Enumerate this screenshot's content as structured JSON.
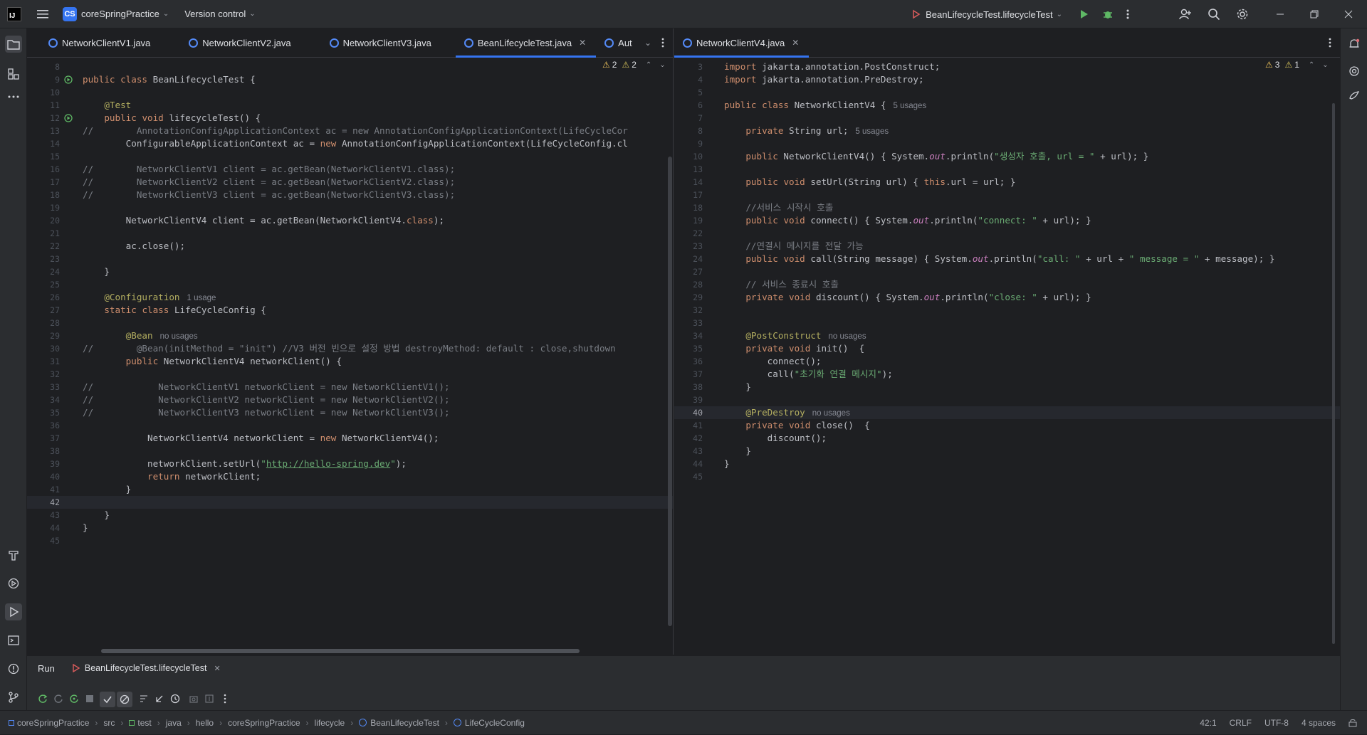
{
  "titlebar": {
    "project_badge": "CS",
    "project_name": "coreSpringPractice",
    "vcs": "Version control",
    "run_config": "BeanLifecycleTest.lifecycleTest"
  },
  "left_editor": {
    "tabs": [
      {
        "label": "NetworkClientV1.java",
        "active": false
      },
      {
        "label": "NetworkClientV2.java",
        "active": false
      },
      {
        "label": "NetworkClientV3.java",
        "active": false
      },
      {
        "label": "BeanLifecycleTest.java",
        "active": true
      },
      {
        "label": "AutoAppCon",
        "active": false
      }
    ],
    "warnings": "2",
    "weak_warnings": "2"
  },
  "right_editor": {
    "tabs": [
      {
        "label": "NetworkClientV4.java",
        "active": true
      }
    ],
    "warnings": "3",
    "weak_warnings": "1"
  },
  "run_panel": {
    "tab_run": "Run",
    "tab_config": "BeanLifecycleTest.lifecycleTest"
  },
  "statusbar": {
    "breadcrumbs": [
      "coreSpringPractice",
      "src",
      "test",
      "java",
      "hello",
      "coreSpringPractice",
      "lifecycle",
      "BeanLifecycleTest",
      "LifeCycleConfig"
    ],
    "position": "42:1",
    "line_sep": "CRLF",
    "encoding": "UTF-8",
    "indent": "4 spaces"
  },
  "colors": {
    "accent": "#3574f0",
    "keyword": "#cf8e6d",
    "annotation": "#b3ae60",
    "string": "#6aab73",
    "comment": "#7a7e85",
    "function": "#56a8f5",
    "field": "#c77dbb",
    "warning": "#f2c55c"
  },
  "icons": [
    "menu-icon",
    "run-icon",
    "debug-icon",
    "more-icon",
    "add-user-icon",
    "search-icon",
    "gear-icon",
    "minimize-icon",
    "maximize-icon",
    "close-icon",
    "folder-icon",
    "structure-icon",
    "build-icon",
    "services-icon",
    "run-tool-icon",
    "terminal-icon",
    "problems-icon",
    "git-icon",
    "notifications-icon",
    "ai-icon",
    "database-icon"
  ],
  "left_code": [
    {
      "n": "8",
      "t": ""
    },
    {
      "n": "9",
      "t": "public class BeanLifecycleTest {",
      "run": true
    },
    {
      "n": "10",
      "t": ""
    },
    {
      "n": "11",
      "t": "    @Test"
    },
    {
      "n": "12",
      "t": "    public void lifecycleTest() {",
      "run": true
    },
    {
      "n": "13",
      "t": "//        AnnotationConfigApplicationContext ac = new AnnotationConfigApplicationContext(LifeCycleCor"
    },
    {
      "n": "14",
      "t": "        ConfigurableApplicationContext ac = new AnnotationConfigApplicationContext(LifeCycleConfig.cl"
    },
    {
      "n": "15",
      "t": ""
    },
    {
      "n": "16",
      "t": "//        NetworkClientV1 client = ac.getBean(NetworkClientV1.class);"
    },
    {
      "n": "17",
      "t": "//        NetworkClientV2 client = ac.getBean(NetworkClientV2.class);"
    },
    {
      "n": "18",
      "t": "//        NetworkClientV3 client = ac.getBean(NetworkClientV3.class);"
    },
    {
      "n": "19",
      "t": ""
    },
    {
      "n": "20",
      "t": "        NetworkClientV4 client = ac.getBean(NetworkClientV4.class);"
    },
    {
      "n": "21",
      "t": ""
    },
    {
      "n": "22",
      "t": "        ac.close();"
    },
    {
      "n": "23",
      "t": ""
    },
    {
      "n": "24",
      "t": "    }"
    },
    {
      "n": "25",
      "t": ""
    },
    {
      "n": "26",
      "t": "    @Configuration",
      "hint": "1 usage"
    },
    {
      "n": "27",
      "t": "    static class LifeCycleConfig {"
    },
    {
      "n": "28",
      "t": ""
    },
    {
      "n": "29",
      "t": "        @Bean",
      "hint": "no usages"
    },
    {
      "n": "30",
      "t": "//        @Bean(initMethod = \"init\") //V3 버전 빈으로 설정 방법 destroyMethod: default : close,shutdown"
    },
    {
      "n": "31",
      "t": "        public NetworkClientV4 networkClient() {"
    },
    {
      "n": "32",
      "t": ""
    },
    {
      "n": "33",
      "t": "//            NetworkClientV1 networkClient = new NetworkClientV1();"
    },
    {
      "n": "34",
      "t": "//            NetworkClientV2 networkClient = new NetworkClientV2();"
    },
    {
      "n": "35",
      "t": "//            NetworkClientV3 networkClient = new NetworkClientV3();"
    },
    {
      "n": "36",
      "t": ""
    },
    {
      "n": "37",
      "t": "            NetworkClientV4 networkClient = new NetworkClientV4();"
    },
    {
      "n": "38",
      "t": ""
    },
    {
      "n": "39",
      "t": "            networkClient.setUrl(\"http://hello-spring.dev\");"
    },
    {
      "n": "40",
      "t": "            return networkClient;"
    },
    {
      "n": "41",
      "t": "        }"
    },
    {
      "n": "42",
      "t": "",
      "current": true
    },
    {
      "n": "43",
      "t": "    }"
    },
    {
      "n": "44",
      "t": "}"
    },
    {
      "n": "45",
      "t": ""
    }
  ],
  "right_code": [
    {
      "n": "3",
      "t": "import jakarta.annotation.PostConstruct;"
    },
    {
      "n": "4",
      "t": "import jakarta.annotation.PreDestroy;"
    },
    {
      "n": "5",
      "t": ""
    },
    {
      "n": "6",
      "t": "public class NetworkClientV4 {",
      "hint": "5 usages"
    },
    {
      "n": "7",
      "t": ""
    },
    {
      "n": "8",
      "t": "    private String url;",
      "hint": "5 usages"
    },
    {
      "n": "9",
      "t": ""
    },
    {
      "n": "10",
      "t": "    public NetworkClientV4() { System.out.println(\"생성자 호출, url = \" + url); }"
    },
    {
      "n": "13",
      "t": ""
    },
    {
      "n": "14",
      "t": "    public void setUrl(String url) { this.url = url; }"
    },
    {
      "n": "17",
      "t": ""
    },
    {
      "n": "18",
      "t": "    //서비스 시작시 호출"
    },
    {
      "n": "19",
      "t": "    public void connect() { System.out.println(\"connect: \" + url); }"
    },
    {
      "n": "22",
      "t": ""
    },
    {
      "n": "23",
      "t": "    //연결시 메시지를 전달 가능"
    },
    {
      "n": "24",
      "t": "    public void call(String message) { System.out.println(\"call: \" + url + \" message = \" + message); }"
    },
    {
      "n": "27",
      "t": ""
    },
    {
      "n": "28",
      "t": "    // 서비스 종료시 호출"
    },
    {
      "n": "29",
      "t": "    private void discount() { System.out.println(\"close: \" + url); }"
    },
    {
      "n": "32",
      "t": ""
    },
    {
      "n": "33",
      "t": ""
    },
    {
      "n": "34",
      "t": "    @PostConstruct",
      "hint": "no usages"
    },
    {
      "n": "35",
      "t": "    private void init()  {"
    },
    {
      "n": "36",
      "t": "        connect();"
    },
    {
      "n": "37",
      "t": "        call(\"초기화 연결 메시지\");"
    },
    {
      "n": "38",
      "t": "    }"
    },
    {
      "n": "39",
      "t": ""
    },
    {
      "n": "40",
      "t": "    @PreDestroy",
      "hint": "no usages",
      "current": true
    },
    {
      "n": "41",
      "t": "    private void close()  {"
    },
    {
      "n": "42",
      "t": "        discount();"
    },
    {
      "n": "43",
      "t": "    }"
    },
    {
      "n": "44",
      "t": "}"
    },
    {
      "n": "45",
      "t": ""
    }
  ]
}
